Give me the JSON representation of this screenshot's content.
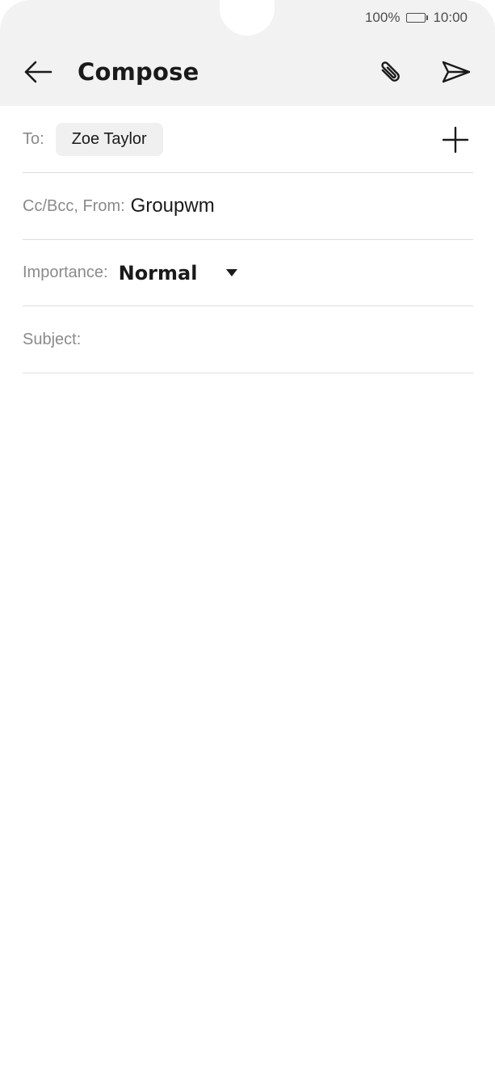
{
  "status_bar": {
    "battery_percent": "100%",
    "time": "10:00"
  },
  "toolbar": {
    "title": "Compose",
    "back_icon": "arrow-left-icon",
    "attach_icon": "paperclip-icon",
    "send_icon": "send-icon"
  },
  "form": {
    "to_label": "To:",
    "to_recipient": "Zoe Taylor",
    "add_icon": "plus-icon",
    "cc_label": "Cc/Bcc, From:",
    "from_value": "Groupwm",
    "importance_label": "Importance:",
    "importance_value": "Normal",
    "subject_label": "Subject:",
    "subject_value": ""
  },
  "colors": {
    "header_bg": "#f2f2f2",
    "chip_bg": "#f0f0f0",
    "label_text": "#8a8a8a",
    "primary_text": "#1a1a1a",
    "divider": "#dcdcdc"
  }
}
